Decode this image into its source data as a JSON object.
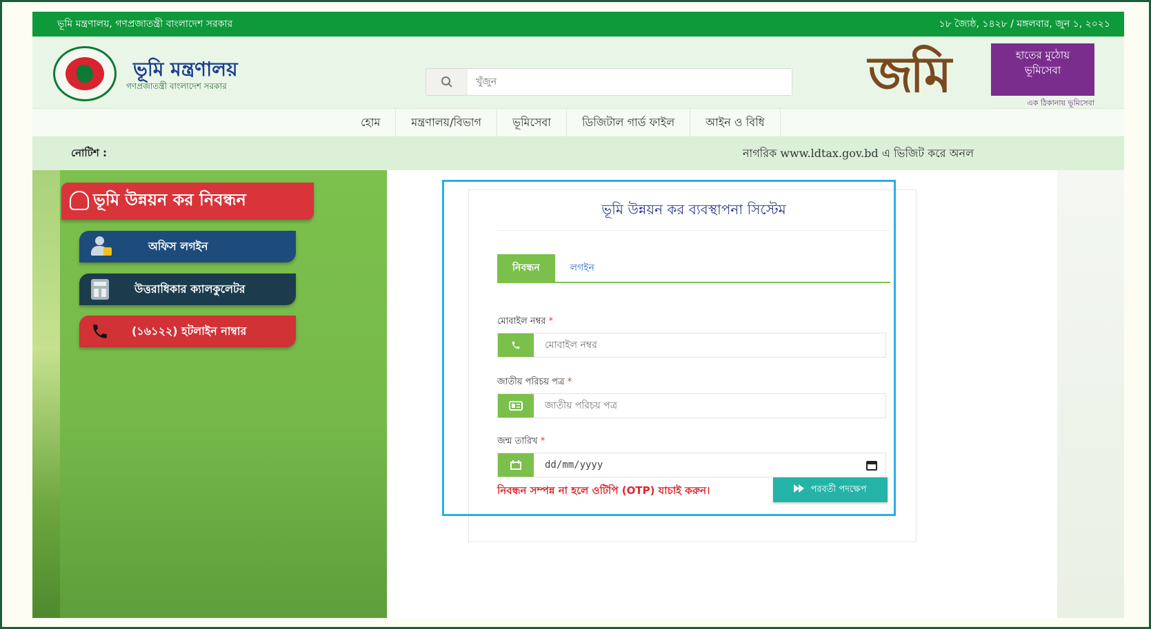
{
  "topbar": {
    "ministry_text": "ভূমি মন্ত্রণালয়, গণপ্রজাতন্ত্রী বাংলাদেশ সরকার",
    "date_text": "১৮ জ্যৈষ্ঠ, ১৪২৮ / মঙ্গলবার, জুন ১, ২০২১"
  },
  "header": {
    "brand_title": "ভূমি মন্ত্রণালয়",
    "brand_subtitle": "গণপ্রজাতন্ত্রী বাংলাদেশ সরকার",
    "search_placeholder": "খুঁজুন",
    "jomi_logo": "জমি",
    "jomi_badge_line1": "হাতের মুঠোয়",
    "jomi_badge_line2": "ভূমিসেবা",
    "jomi_tagline": "এক ঠিকানায় ভূমিসেবা"
  },
  "nav": {
    "items": [
      {
        "label": "হোম"
      },
      {
        "label": "মন্ত্রণালয়/বিভাগ"
      },
      {
        "label": "ভূমিসেবা"
      },
      {
        "label": "ডিজিটাল গার্ড ফাইল"
      },
      {
        "label": "আইন ও বিধি"
      }
    ]
  },
  "notice": {
    "label": "নোটিশ :",
    "ticker": "নাগরিক www.ldtax.gov.bd এ ভিজিট করে অনল"
  },
  "sidebar": {
    "register_banner": "ভূমি উন্নয়ন কর নিবন্ধন",
    "office_login": "অফিস লগইন",
    "calculator": "উত্তরাধিকার ক্যালকুলেটর",
    "hotline": "(১৬১২২) হটলাইন নাম্বার"
  },
  "form": {
    "title": "ভূমি উন্নয়ন কর ব্যবস্থাপনা সিস্টেম",
    "tabs": [
      {
        "label": "নিবন্ধন",
        "active": true
      },
      {
        "label": "লগইন",
        "active": false
      }
    ],
    "mobile_label": "মোবাইল নম্বর",
    "mobile_placeholder": "মোবাইল নম্বর",
    "nid_label": "জাতীয় পরিচয় পত্র",
    "nid_placeholder": "জাতীয় পরিচয় পত্র",
    "dob_label": "জন্ম তারিখ",
    "dob_placeholder": "dd/mm/yyyy",
    "required_mark": "*",
    "otp_note": "নিবন্ধন সম্পন্ন না হলে ওটিপি (OTP) যাচাই করুন।",
    "next_button": "পরবর্তী পদক্ষেপ"
  },
  "colors": {
    "top_bar": "#0e9a3a",
    "accent_green": "#7ac04a",
    "highlight_border": "#29aee6",
    "next_button": "#25b3a7",
    "required": "#e23434"
  },
  "icons": {
    "search": "search-icon",
    "phone": "phone-icon",
    "id_card": "id-card-icon",
    "calendar": "calendar-icon",
    "next": "fast-forward-icon"
  }
}
